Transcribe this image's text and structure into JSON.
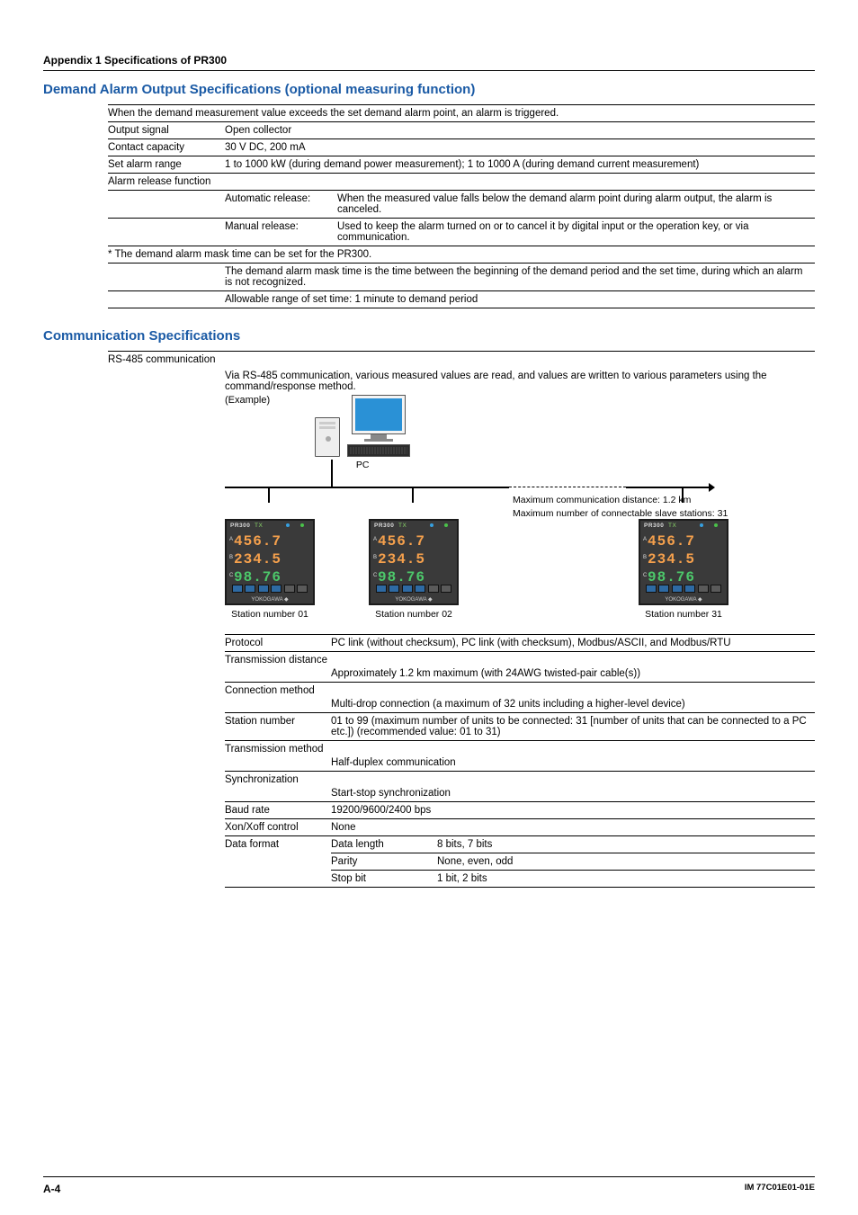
{
  "header": {
    "appendix": "Appendix 1   Specifications of PR300"
  },
  "s1": {
    "title": "Demand Alarm Output Specifications (optional measuring function)",
    "intro": "When the demand measurement value exceeds the set demand alarm point, an alarm is triggered.",
    "rows": [
      {
        "label": "Output signal",
        "value": "Open collector"
      },
      {
        "label": "Contact capacity",
        "value": "30 V DC, 200 mA"
      },
      {
        "label": "Set alarm range",
        "value": "1 to 1000 kW (during demand power measurement); 1 to 1000 A (during demand current measurement)"
      }
    ],
    "alarm_release_label": "Alarm release function",
    "auto": {
      "label": "Automatic release:",
      "value": "When the measured value falls below the demand alarm point during alarm output, the alarm is canceled."
    },
    "manual": {
      "label": "Manual release:",
      "value": "Used to keep the alarm turned on or to cancel it by digital input or the operation key, or via communication."
    },
    "note_star": "* The demand alarm mask time can be set for the PR300.",
    "note_body": "The demand alarm mask time is the time between the beginning of the demand period and the set time, during which an alarm is not recognized.",
    "note_range": "Allowable range of set time: 1 minute to demand period"
  },
  "s2": {
    "title": "Communication Specifications",
    "rs485_label": "RS-485 communication",
    "rs485_desc": "Via RS-485 communication, various measured values are read, and values are written to various parameters using the command/response method.",
    "diagram": {
      "example": "(Example)",
      "pc": "PC",
      "bus1": "Maximum communication distance: 1.2 km",
      "bus2": "Maximum number of connectable slave stations: 31",
      "dev_brand": "PR300",
      "disp1": "456.7",
      "disp2": "234.5",
      "disp3": "98.76",
      "yokogawa": "YOKOGAWA ◆",
      "st1": "Station number 01",
      "st2": "Station number 02",
      "st3": "Station number 31"
    },
    "specs": {
      "protocol": {
        "label": "Protocol",
        "value": "PC link (without checksum), PC link (with checksum), Modbus/ASCII, and Modbus/RTU"
      },
      "tdist": {
        "label": "Transmission distance",
        "value": "Approximately 1.2 km maximum (with 24AWG twisted-pair cable(s))"
      },
      "conn": {
        "label": "Connection method",
        "value": "Multi-drop connection (a maximum of 32 units including a higher-level device)"
      },
      "station": {
        "label": "Station number",
        "value": "01 to 99 (maximum number of units to be connected: 31 [number of units that can be connected to a PC etc.]) (recommended value: 01 to 31)"
      },
      "tmethod": {
        "label": "Transmission method",
        "value": "Half-duplex communication"
      },
      "sync": {
        "label": "Synchronization",
        "value": "Start-stop synchronization"
      },
      "baud": {
        "label": "Baud rate",
        "value": "19200/9600/2400 bps"
      },
      "xon": {
        "label": "Xon/Xoff control",
        "value": "None"
      },
      "dformat": {
        "label": "Data format",
        "items": [
          {
            "sub": "Data length",
            "val": "8 bits, 7 bits"
          },
          {
            "sub": "Parity",
            "val": "None, even, odd"
          },
          {
            "sub": "Stop bit",
            "val": "1 bit, 2 bits"
          }
        ]
      }
    }
  },
  "footer": {
    "page": "A-4",
    "doc": "IM 77C01E01-01E"
  }
}
